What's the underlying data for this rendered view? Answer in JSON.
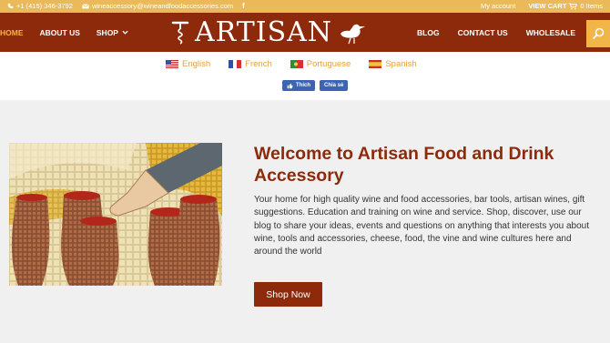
{
  "topbar": {
    "phone": "+1 (415) 346-3792",
    "email": "wineaccessory@wineandfoodaccessories.com",
    "account": "My account",
    "cart": "VIEW CART",
    "items": "0 Items"
  },
  "nav": {
    "home": "HOME",
    "about": "ABOUT US",
    "shop": "SHOP",
    "logo": "ARTISAN",
    "blog": "BLOG",
    "contact": "CONTACT US",
    "wholesale": "WHOLESALE"
  },
  "languages": [
    "English",
    "French",
    "Portuguese",
    "Spanish"
  ],
  "social": {
    "like": "Thích",
    "share": "Chia sẻ"
  },
  "main": {
    "title": "Welcome to Artisan Food and Drink Accessory",
    "description": "Your home for high quality wine and food accessories, bar tools, artisan wines, gift suggestions. Education and training on wine and service. Shop, discover, use our blog to share your ideas, events and questions on anything that interests you about wine, tools and accessories, cheese, food, the vine and wine cultures here and around the world",
    "cta": "Shop Now"
  },
  "colors": {
    "brand": "#8d2a0b",
    "accent": "#ecb95a"
  }
}
